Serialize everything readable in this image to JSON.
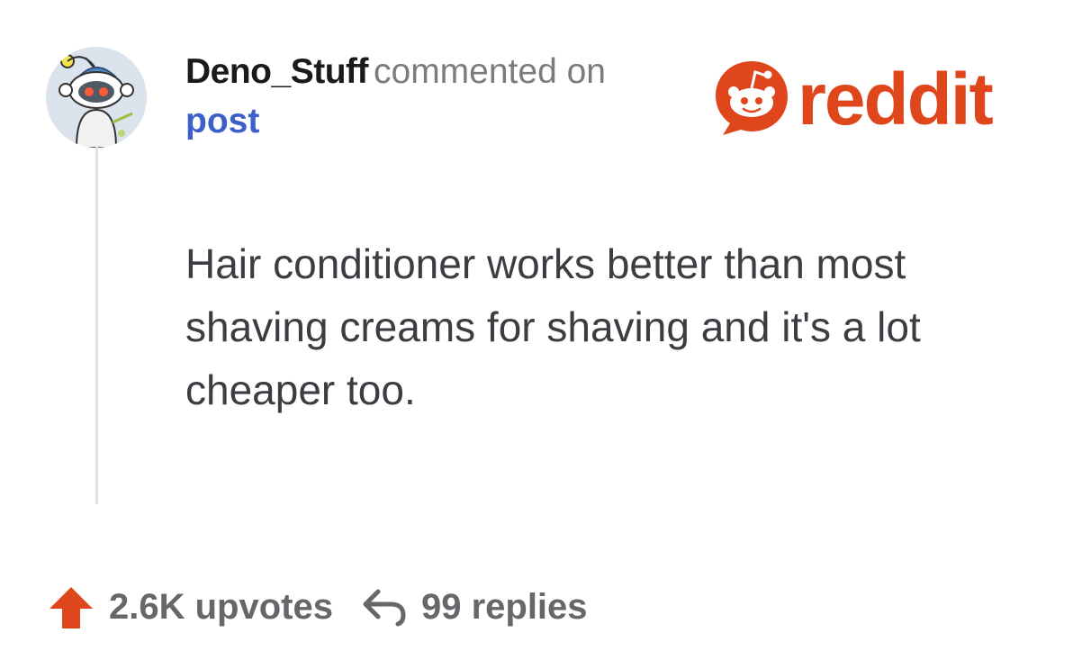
{
  "comment": {
    "username": "Deno_Stuff",
    "action_text": "commented on",
    "target_link": "post",
    "body": "Hair conditioner works better than most shaving creams for shaving and it's a lot cheaper too."
  },
  "brand": {
    "logo_text": "reddit",
    "logo_color": "#e0461b"
  },
  "footer": {
    "upvotes_label": "2.6K upvotes",
    "replies_label": "99 replies",
    "upvote_color": "#e0461b"
  },
  "icons": {
    "avatar": "snoo-avatar",
    "logo": "reddit-snoo-icon",
    "upvote": "upvote-arrow-icon",
    "reply": "reply-arrow-icon"
  }
}
